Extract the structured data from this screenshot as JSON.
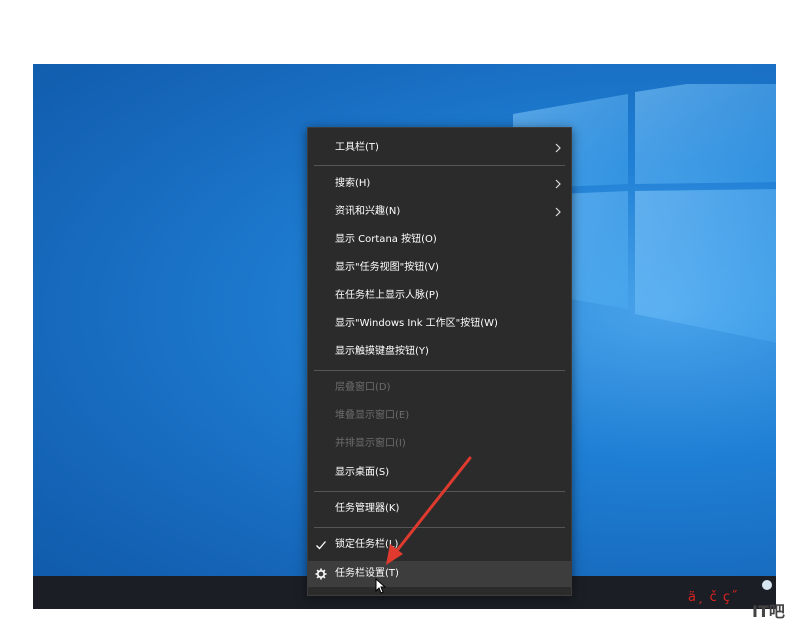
{
  "menu": {
    "items": [
      {
        "label": "工具栏(T)",
        "submenu": true,
        "enabled": true
      },
      {
        "label": "搜索(H)",
        "submenu": true,
        "enabled": true
      },
      {
        "label": "资讯和兴趣(N)",
        "submenu": true,
        "enabled": true
      },
      {
        "label": "显示 Cortana 按钮(O)",
        "submenu": false,
        "enabled": true
      },
      {
        "label": "显示\"任务视图\"按钮(V)",
        "submenu": false,
        "enabled": true
      },
      {
        "label": "在任务栏上显示人脉(P)",
        "submenu": false,
        "enabled": true
      },
      {
        "label": "显示\"Windows Ink 工作区\"按钮(W)",
        "submenu": false,
        "enabled": true
      },
      {
        "label": "显示触摸键盘按钮(Y)",
        "submenu": false,
        "enabled": true
      },
      {
        "label": "层叠窗口(D)",
        "submenu": false,
        "enabled": false
      },
      {
        "label": "堆叠显示窗口(E)",
        "submenu": false,
        "enabled": false
      },
      {
        "label": "并排显示窗口(I)",
        "submenu": false,
        "enabled": false
      },
      {
        "label": "显示桌面(S)",
        "submenu": false,
        "enabled": true
      },
      {
        "label": "任务管理器(K)",
        "submenu": false,
        "enabled": true
      },
      {
        "label": "锁定任务栏(L)",
        "submenu": false,
        "enabled": true,
        "checked": true
      },
      {
        "label": "任务栏设置(T)",
        "submenu": false,
        "enabled": true,
        "icon": "gear-icon",
        "hovered": true
      }
    ]
  },
  "watermark": {
    "red_text": "ä¸ č  ç˝",
    "gray_text": "IT吧"
  },
  "colors": {
    "menu_bg": "#2b2b2b",
    "desktop_blue": "#1f7fd4",
    "taskbar": "#1b1f25",
    "annotation_arrow": "#e03a2f"
  }
}
